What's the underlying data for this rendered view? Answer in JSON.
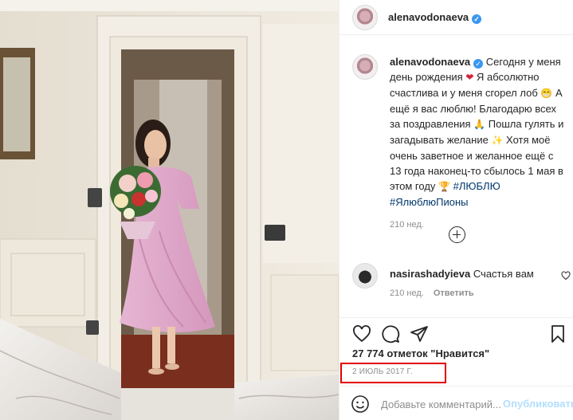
{
  "post": {
    "username": "alenavodonaeva",
    "verified_glyph": "✓"
  },
  "caption": {
    "username": "alenavodonaeva",
    "text_1": "Сегодня у меня день рождения",
    "emoji_1": "❤",
    "text_2": "Я абсолютно счастлива и у меня сгорел лоб",
    "emoji_2": "😁",
    "text_3": "А ещё я вас люблю! Благодарю всех за поздравления",
    "emoji_3": "🙏",
    "text_4": "Пошла гулять и загадывать желание",
    "emoji_4": "✨",
    "text_5": "Хотя моё очень заветное и желанное ещё с 13 года наконец-то сбылось 1 мая в этом году",
    "emoji_5": "🏆",
    "hashtag_1": "#ЛЮБЛЮ",
    "hashtag_2": "#ЯлюблюПионы",
    "time": "210 нед."
  },
  "comments": [
    {
      "username": "nasirashadyieva",
      "text": "Счастья вам",
      "time": "210 нед.",
      "reply_label": "Ответить"
    }
  ],
  "likes_text": "27 774 отметок \"Нравится\"",
  "date": "2 ИЮЛЬ 2017 Г.",
  "add_comment": {
    "placeholder": "Добавьте комментарий...",
    "post_label": "Опубликовать"
  },
  "icons": {
    "like": "heart-icon",
    "comment": "comment-icon",
    "share": "share-icon",
    "save": "bookmark-icon",
    "load_more": "plus-circle-icon",
    "emoji": "smile-icon"
  },
  "colors": {
    "highlight": "#e40000",
    "verified": "#3897f0",
    "hashtag": "#00376b",
    "muted": "#8e8e8e"
  }
}
